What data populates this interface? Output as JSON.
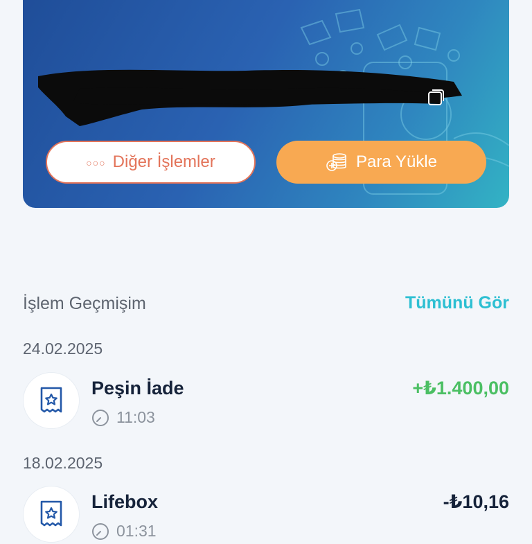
{
  "card": {
    "actions": {
      "other_label": "Diğer İşlemler",
      "load_label": "Para Yükle"
    }
  },
  "history": {
    "title": "İşlem Geçmişim",
    "see_all": "Tümünü Gör",
    "groups": [
      {
        "date": "24.02.2025",
        "transactions": [
          {
            "title": "Peşin İade",
            "time": "11:03",
            "amount": "+₺1.400,00",
            "type": "credit"
          }
        ]
      },
      {
        "date": "18.02.2025",
        "transactions": [
          {
            "title": "Lifebox",
            "time": "01:31",
            "amount": "-₺10,16",
            "type": "debit"
          }
        ]
      }
    ]
  },
  "colors": {
    "accent": "#2cbfd2",
    "positive": "#4bbf63",
    "button_primary": "#f8a952",
    "button_secondary_border": "#e3745a"
  }
}
